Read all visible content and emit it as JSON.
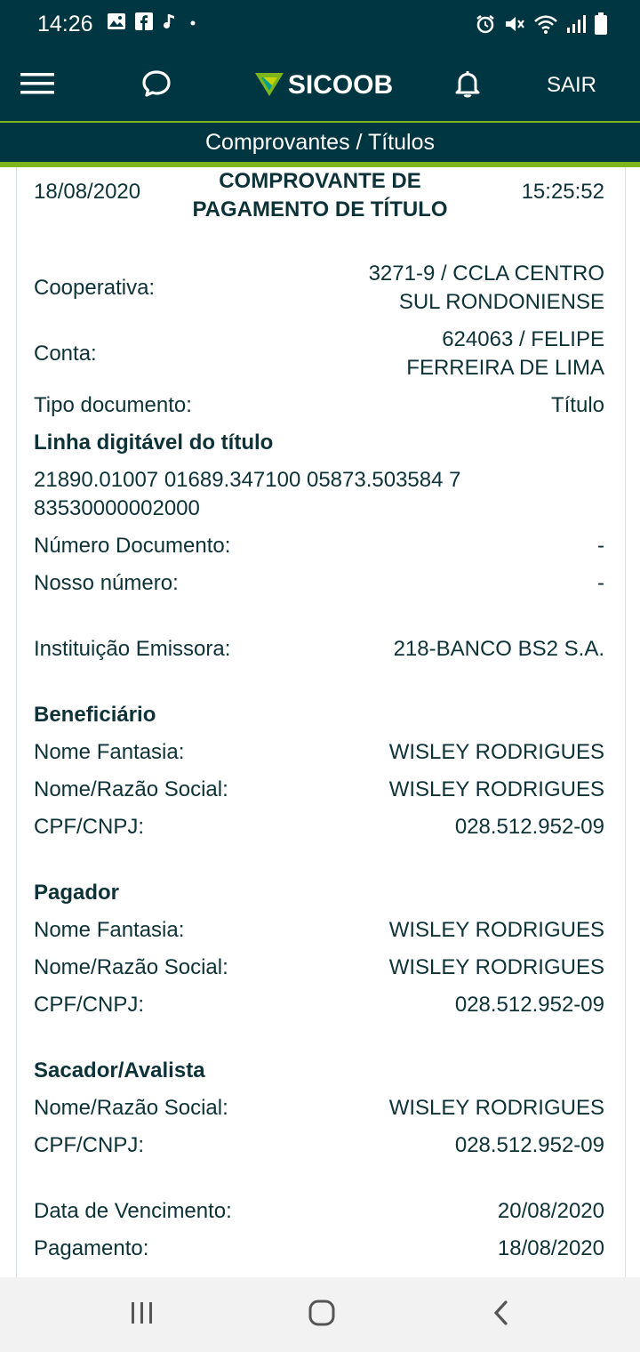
{
  "status_bar": {
    "time": "14:26",
    "left_icons": [
      "image-icon",
      "facebook-icon",
      "music-note-icon",
      "dot-icon"
    ],
    "right_icons": [
      "alarm-icon",
      "mute-icon",
      "wifi-icon",
      "signal-icon",
      "battery-icon"
    ]
  },
  "header": {
    "logo_text": "SICOOB",
    "logout_label": "SAIR"
  },
  "subheader": {
    "title": "Comprovantes / Títulos"
  },
  "receipt": {
    "date": "18/08/2020",
    "time": "15:25:52",
    "title_line1": "COMPROVANTE DE",
    "title_line2": "PAGAMENTO DE TÍTULO",
    "cooperativa_label": "Cooperativa:",
    "cooperativa_line1": "3271-9 / CCLA CENTRO",
    "cooperativa_line2": "SUL RONDONIENSE",
    "conta_label": "Conta:",
    "conta_line1": "624063 / FELIPE",
    "conta_line2": "FERREIRA DE LIMA",
    "tipo_label": "Tipo documento:",
    "tipo_value": "Título",
    "linha_heading": "Linha digitável do título",
    "linha_line1": "21890.01007 01689.347100 05873.503584 7",
    "linha_line2": "83530000002000",
    "numero_label": "Número Documento:",
    "numero_value": "-",
    "nosso_label": "Nosso número:",
    "nosso_value": "-",
    "instituicao_label": "Instituição Emissora:",
    "instituicao_value": "218-BANCO BS2 S.A.",
    "beneficiario": {
      "heading": "Beneficiário",
      "fantasia_label": "Nome Fantasia:",
      "fantasia_value": "WISLEY RODRIGUES",
      "razao_label": "Nome/Razão Social:",
      "razao_value": "WISLEY RODRIGUES",
      "cpf_label": "CPF/CNPJ:",
      "cpf_value": "028.512.952-09"
    },
    "pagador": {
      "heading": "Pagador",
      "fantasia_label": "Nome Fantasia:",
      "fantasia_value": "WISLEY RODRIGUES",
      "razao_label": "Nome/Razão Social:",
      "razao_value": "WISLEY RODRIGUES",
      "cpf_label": "CPF/CNPJ:",
      "cpf_value": "028.512.952-09"
    },
    "sacador": {
      "heading": "Sacador/Avalista",
      "razao_label": "Nome/Razão Social:",
      "razao_value": "WISLEY RODRIGUES",
      "cpf_label": "CPF/CNPJ:",
      "cpf_value": "028.512.952-09"
    },
    "vencimento_label": "Data de Vencimento:",
    "vencimento_value": "20/08/2020",
    "pagamento_label": "Pagamento:",
    "pagamento_value": "18/08/2020"
  },
  "nav_bar": {
    "icons": [
      "recent-apps-icon",
      "home-icon",
      "back-icon"
    ]
  },
  "colors": {
    "header_bg": "#003641",
    "accent_green": "#7db61c",
    "text_dark": "#0d3238"
  }
}
